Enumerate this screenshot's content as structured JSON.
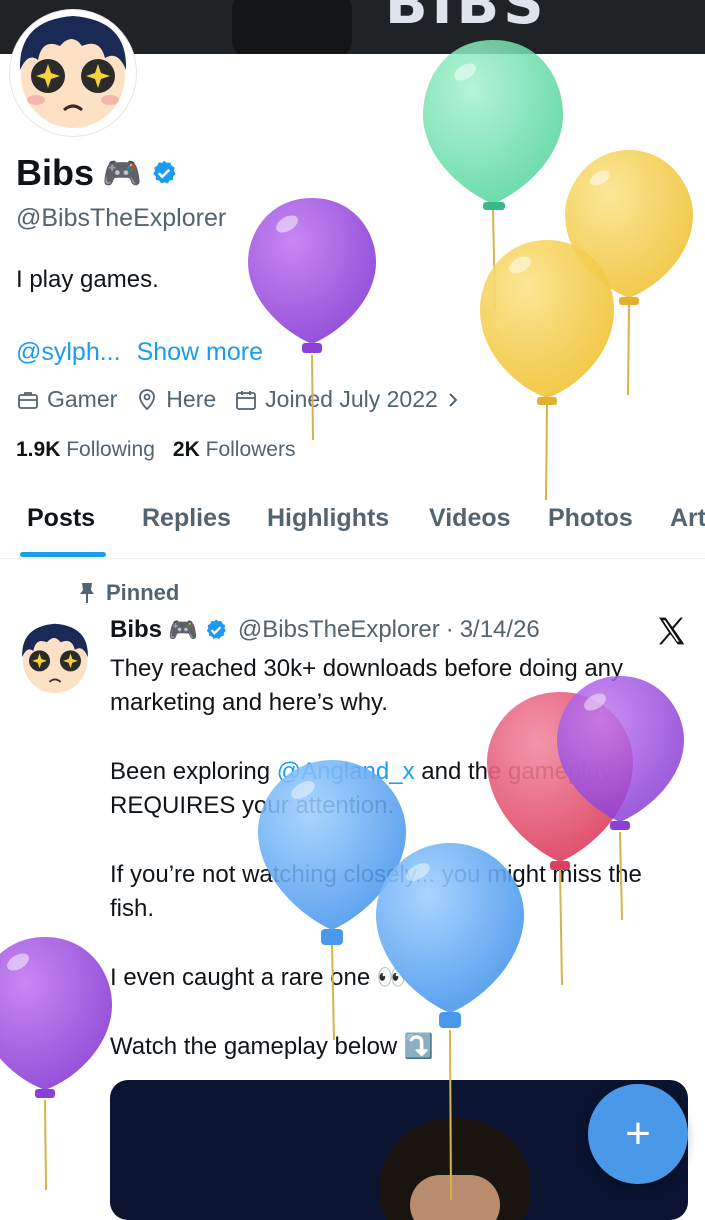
{
  "banner": {
    "logo_text": "BIBS"
  },
  "profile": {
    "name": "Bibs",
    "name_emoji": "🎮",
    "handle": "@BibsTheExplorer",
    "bio": "I play games.",
    "mention_link": "@sylph...",
    "show_more": "Show more",
    "category": "Gamer",
    "location": "Here",
    "joined": "Joined July 2022",
    "following_count": "1.9K",
    "following_label": "Following",
    "followers_count": "2K",
    "followers_label": "Followers"
  },
  "tabs": [
    "Posts",
    "Replies",
    "Highlights",
    "Videos",
    "Photos",
    "Art"
  ],
  "active_tab": "Posts",
  "post": {
    "pinned_label": "Pinned",
    "author": "Bibs",
    "author_emoji": "🎮",
    "handle": "@BibsTheExplorer",
    "separator": "·",
    "date": "3/14/26",
    "line1": "They reached 30k+ downloads before doing any marketing and here’s why.",
    "line2_a": "Been exploring ",
    "line2_mention": "@Angland_x",
    "line2_b": " and the gameplay REQUIRES your attention.",
    "line3": "If you’re not watching closely... you might miss the fish.",
    "line4": "I even caught a rare one 👀",
    "line5": "Watch the gameplay below ⤵️"
  },
  "fab_label": "+",
  "colors": {
    "accent": "#1d9bf0",
    "fab": "#4a99e9",
    "verified": "#1d9bf0",
    "banner": "#1f2326"
  }
}
